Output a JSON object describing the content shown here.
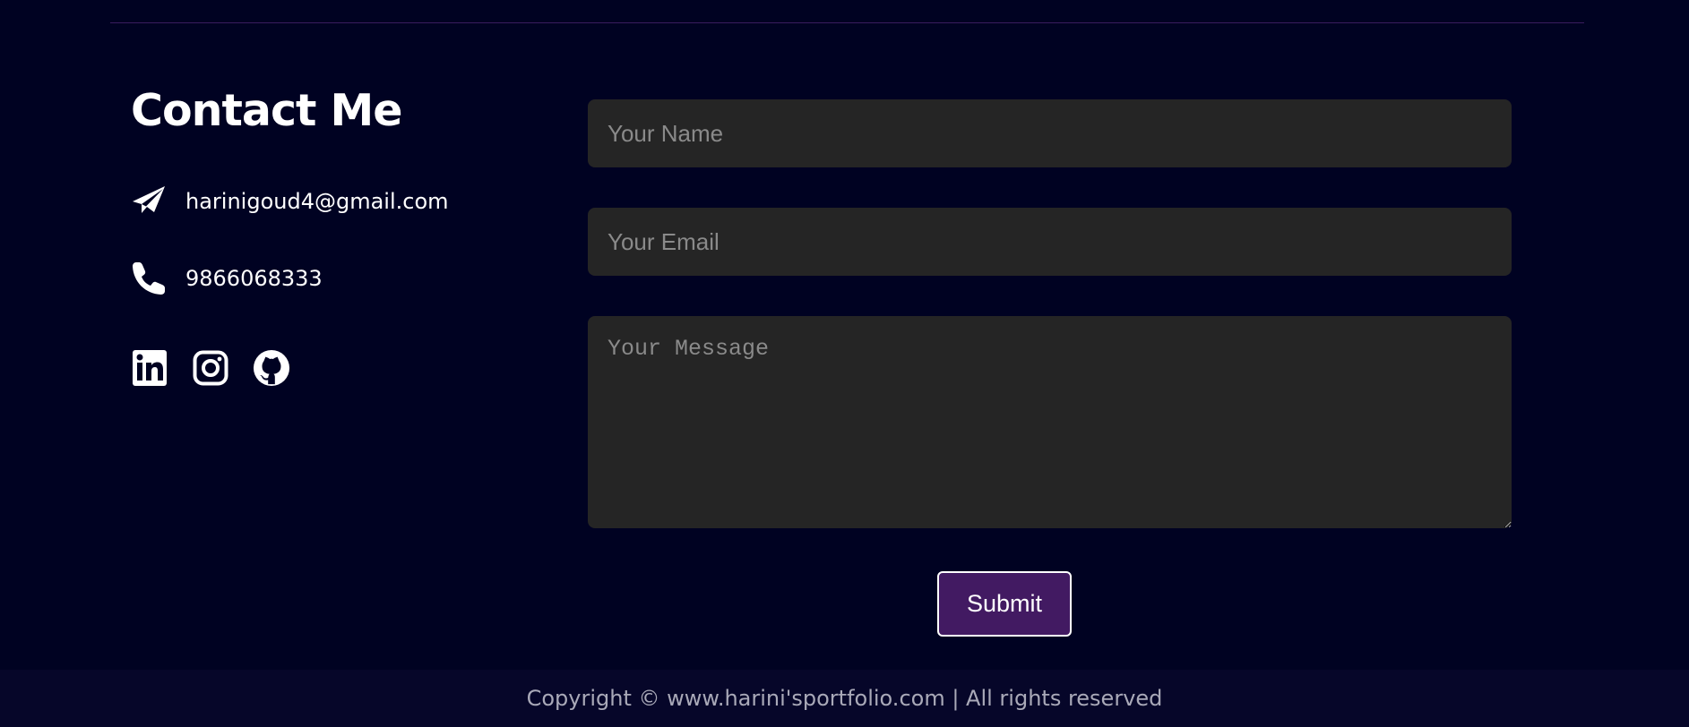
{
  "contact": {
    "title": "Contact Me",
    "email": "harinigoud4@gmail.com",
    "phone": "9866068333",
    "icons": {
      "email": "paper-plane-icon",
      "phone": "phone-icon"
    },
    "social": [
      {
        "name": "linkedin-icon"
      },
      {
        "name": "instagram-icon"
      },
      {
        "name": "github-icon"
      }
    ]
  },
  "form": {
    "name_placeholder": "Your Name",
    "email_placeholder": "Your Email",
    "message_placeholder": "Your Message",
    "submit_label": "Submit"
  },
  "footer": {
    "copyright": "Copyright © www.harini'sportfolio.com | All rights reserved"
  },
  "colors": {
    "background": "#000222",
    "field_background": "#252525",
    "accent": "#421a62",
    "divider": "#3a1c5e",
    "footer_background": "#060629"
  }
}
